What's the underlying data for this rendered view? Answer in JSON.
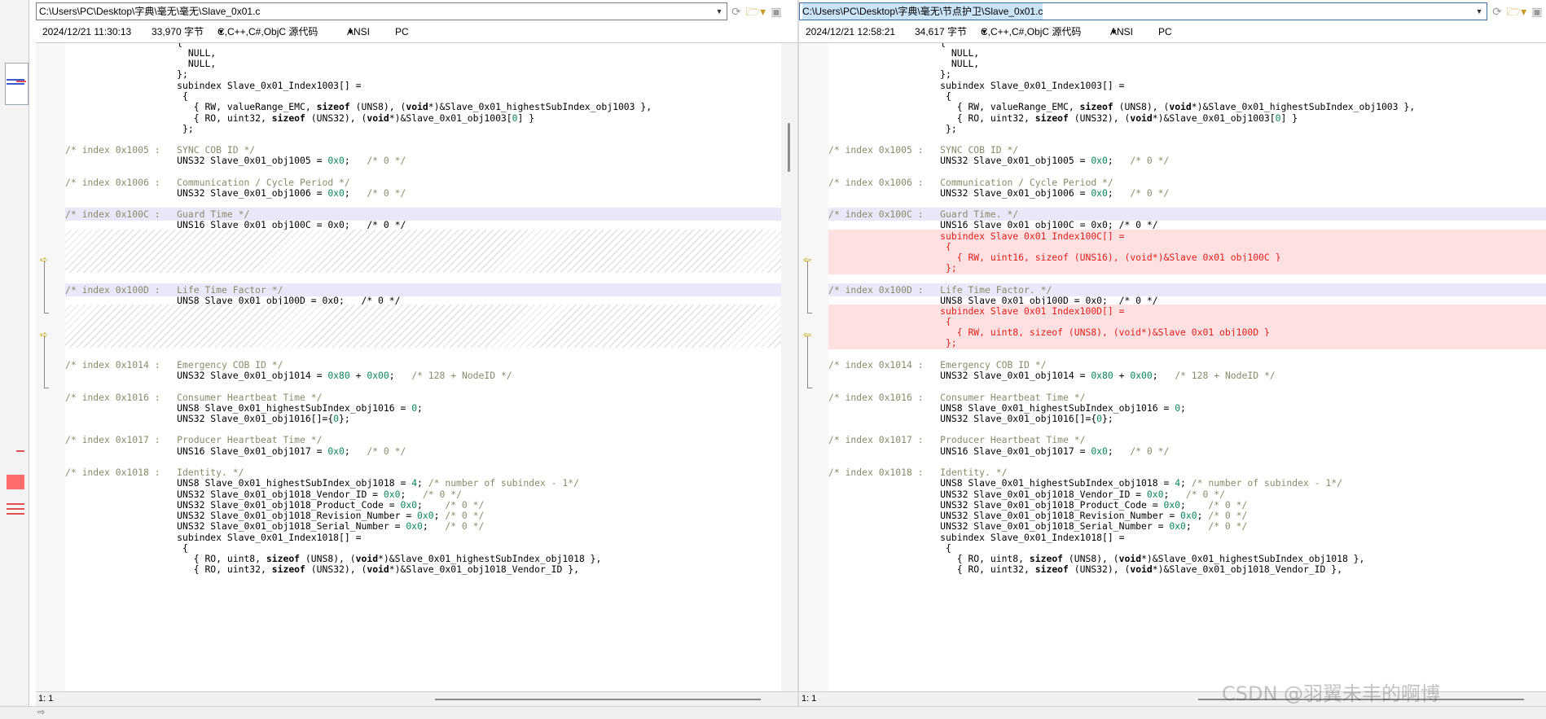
{
  "left": {
    "path": "C:\\Users\\PC\\Desktop\\字典\\毫无\\毫无\\Slave_0x01.c",
    "date": "2024/12/21 11:30:13",
    "size": "33,970 字节",
    "language": "C,C++,C#,ObjC 源代码",
    "encoding": "ANSI",
    "lineend": "PC",
    "status": "1: 1"
  },
  "right": {
    "path": "C:\\Users\\PC\\Desktop\\字典\\毫无\\节点护卫\\Slave_0x01.c",
    "date": "2024/12/21 12:58:21",
    "size": "34,617 字节",
    "language": "C,C++,C#,ObjC 源代码",
    "encoding": "ANSI",
    "lineend": "PC",
    "status": "1: 1"
  },
  "icons": {
    "dropdown": "chevron-down-icon",
    "refresh": "refresh-icon",
    "open": "folder-open-icon",
    "save": "save-icon",
    "diff_marker": "arrow-marker-icon"
  },
  "colors": {
    "changed_bg": "#e8e8f8",
    "added_bg": "#ffe0e0",
    "added_fg": "#e02020",
    "comment": "#8a8a6a",
    "number": "#098658"
  },
  "watermark": "CSDN @羽翼未丰的啊博"
}
